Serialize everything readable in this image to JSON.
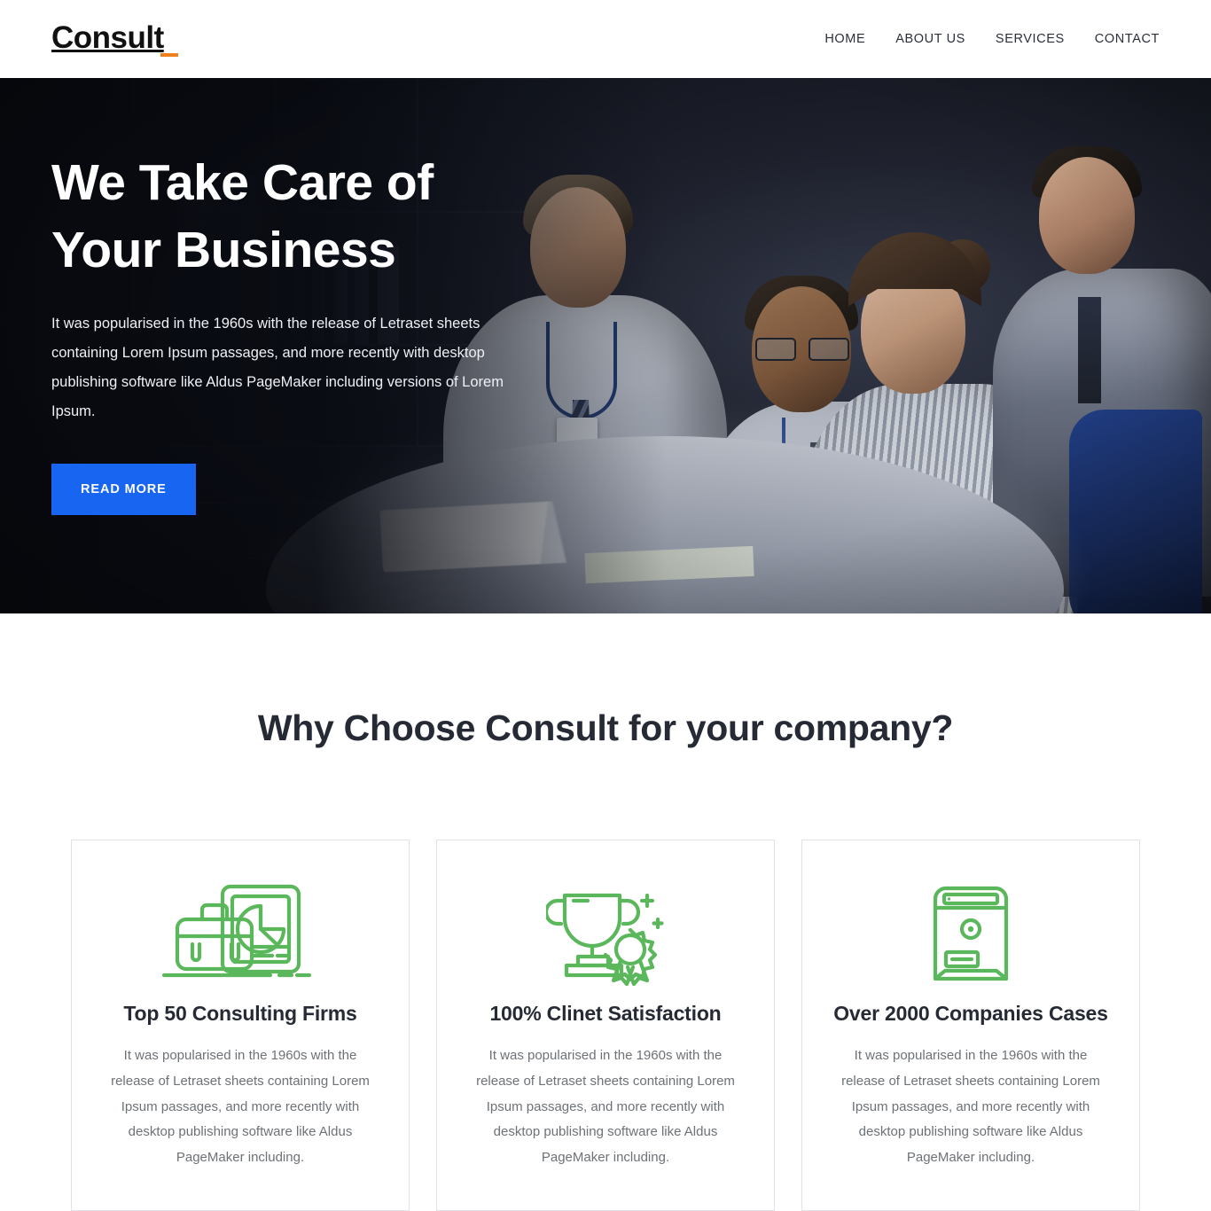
{
  "header": {
    "brand": "Consult",
    "brand_accent_color": "#ef7f1a",
    "nav": [
      {
        "label": "HOME",
        "name": "nav-home"
      },
      {
        "label": "ABOUT US",
        "name": "nav-about-us"
      },
      {
        "label": "SERVICES",
        "name": "nav-services"
      },
      {
        "label": "CONTACT",
        "name": "nav-contact"
      }
    ]
  },
  "hero": {
    "title_line1": "We Take Care of",
    "title_line2": "Your Business",
    "description": "It was popularised in the 1960s with the release of Letraset sheets containing Lorem Ipsum passages, and more recently with desktop publishing software like Aldus PageMaker including versions of Lorem Ipsum.",
    "cta_label": "READ MORE",
    "cta_color": "#1765f0",
    "background_image_alt": "business team meeting around a table in a dark office"
  },
  "features": {
    "section_title": "Why Choose Consult for your company?",
    "icon_color": "#5bb75b",
    "cards": [
      {
        "icon": "briefcase-chart-icon",
        "title": "Top 50 Consulting Firms",
        "text": "It was popularised in the 1960s with the release of Letraset sheets containing Lorem Ipsum passages, and more recently with desktop publishing software like Aldus PageMaker including."
      },
      {
        "icon": "trophy-award-icon",
        "title": "100% Clinet Satisfaction",
        "text": "It was popularised in the 1960s with the release of Letraset sheets containing Lorem Ipsum passages, and more recently with desktop publishing software like Aldus PageMaker including."
      },
      {
        "icon": "safe-vault-icon",
        "title": "Over 2000 Companies Cases",
        "text": "It was popularised in the 1960s with the release of Letraset sheets containing Lorem Ipsum passages, and more recently with desktop publishing software like Aldus PageMaker including."
      }
    ]
  }
}
